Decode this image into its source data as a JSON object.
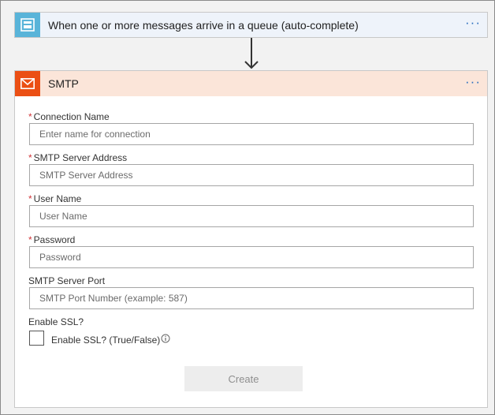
{
  "trigger": {
    "title": "When one or more messages arrive in a queue (auto-complete)",
    "icon": "service-bus-queue-icon",
    "more": "···"
  },
  "smtp": {
    "title": "SMTP",
    "icon": "mail-icon",
    "more": "···",
    "fields": {
      "connection_name": {
        "label": "Connection Name",
        "required_mark": "*",
        "placeholder": "Enter name for connection"
      },
      "server_address": {
        "label": "SMTP Server Address",
        "required_mark": "*",
        "placeholder": "SMTP Server Address"
      },
      "user_name": {
        "label": "User Name",
        "required_mark": "*",
        "placeholder": "User Name"
      },
      "password": {
        "label": "Password",
        "required_mark": "*",
        "placeholder": "Password"
      },
      "server_port": {
        "label": "SMTP Server Port",
        "placeholder": "SMTP Port Number (example: 587)"
      }
    },
    "ssl": {
      "label": "Enable SSL?",
      "checkbox_label": "Enable SSL? (True/False)",
      "checked": false
    },
    "create_label": "Create"
  },
  "colors": {
    "trigger_accent": "#59b4d9",
    "smtp_accent": "#eb4f14",
    "smtp_header_bg": "#fbe5d9",
    "required": "#d13438",
    "link": "#2b6fbf"
  }
}
